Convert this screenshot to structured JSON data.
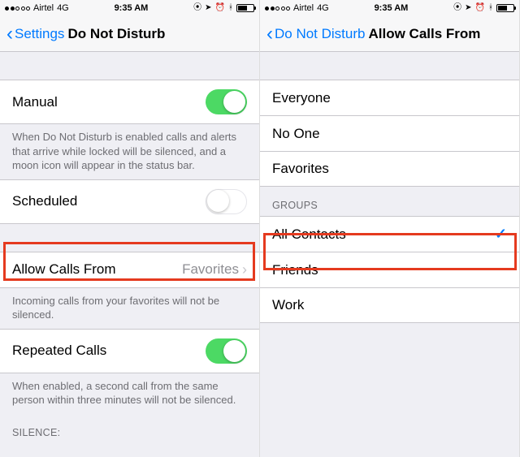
{
  "status": {
    "carrier": "Airtel",
    "network": "4G",
    "time": "9:35 AM"
  },
  "left": {
    "back": "Settings",
    "title": "Do Not Disturb",
    "manual": {
      "label": "Manual",
      "on": true
    },
    "manual_footer": "When Do Not Disturb is enabled calls and alerts that arrive while locked will be silenced, and a moon icon will appear in the status bar.",
    "scheduled": {
      "label": "Scheduled",
      "on": false
    },
    "allow": {
      "label": "Allow Calls From",
      "value": "Favorites"
    },
    "allow_footer": "Incoming calls from your favorites will not be silenced.",
    "repeated": {
      "label": "Repeated Calls",
      "on": true
    },
    "repeated_footer": "When enabled, a second call from the same person within three minutes will not be silenced.",
    "silence_header": "SILENCE:"
  },
  "right": {
    "back": "Do Not Disturb",
    "title": "Allow Calls From",
    "options": {
      "everyone": "Everyone",
      "noone": "No One",
      "favorites": "Favorites"
    },
    "groups_header": "GROUPS",
    "groups": {
      "all": "All Contacts",
      "friends": "Friends",
      "work": "Work"
    },
    "selected": "all"
  }
}
